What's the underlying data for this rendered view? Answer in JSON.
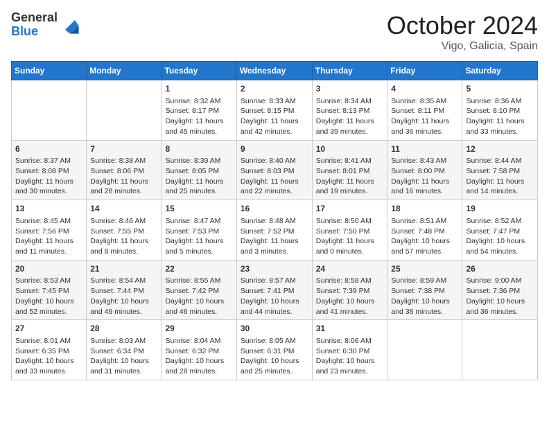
{
  "header": {
    "logo_general": "General",
    "logo_blue": "Blue",
    "month_title": "October 2024",
    "location": "Vigo, Galicia, Spain"
  },
  "days_of_week": [
    "Sunday",
    "Monday",
    "Tuesday",
    "Wednesday",
    "Thursday",
    "Friday",
    "Saturday"
  ],
  "weeks": [
    [
      {
        "day": "",
        "info": ""
      },
      {
        "day": "",
        "info": ""
      },
      {
        "day": "1",
        "info": "Sunrise: 8:32 AM\nSunset: 8:17 PM\nDaylight: 11 hours and 45 minutes."
      },
      {
        "day": "2",
        "info": "Sunrise: 8:33 AM\nSunset: 8:15 PM\nDaylight: 11 hours and 42 minutes."
      },
      {
        "day": "3",
        "info": "Sunrise: 8:34 AM\nSunset: 8:13 PM\nDaylight: 11 hours and 39 minutes."
      },
      {
        "day": "4",
        "info": "Sunrise: 8:35 AM\nSunset: 8:11 PM\nDaylight: 11 hours and 36 minutes."
      },
      {
        "day": "5",
        "info": "Sunrise: 8:36 AM\nSunset: 8:10 PM\nDaylight: 11 hours and 33 minutes."
      }
    ],
    [
      {
        "day": "6",
        "info": "Sunrise: 8:37 AM\nSunset: 8:08 PM\nDaylight: 11 hours and 30 minutes."
      },
      {
        "day": "7",
        "info": "Sunrise: 8:38 AM\nSunset: 8:06 PM\nDaylight: 11 hours and 28 minutes."
      },
      {
        "day": "8",
        "info": "Sunrise: 8:39 AM\nSunset: 8:05 PM\nDaylight: 11 hours and 25 minutes."
      },
      {
        "day": "9",
        "info": "Sunrise: 8:40 AM\nSunset: 8:03 PM\nDaylight: 11 hours and 22 minutes."
      },
      {
        "day": "10",
        "info": "Sunrise: 8:41 AM\nSunset: 8:01 PM\nDaylight: 11 hours and 19 minutes."
      },
      {
        "day": "11",
        "info": "Sunrise: 8:43 AM\nSunset: 8:00 PM\nDaylight: 11 hours and 16 minutes."
      },
      {
        "day": "12",
        "info": "Sunrise: 8:44 AM\nSunset: 7:58 PM\nDaylight: 11 hours and 14 minutes."
      }
    ],
    [
      {
        "day": "13",
        "info": "Sunrise: 8:45 AM\nSunset: 7:56 PM\nDaylight: 11 hours and 11 minutes."
      },
      {
        "day": "14",
        "info": "Sunrise: 8:46 AM\nSunset: 7:55 PM\nDaylight: 11 hours and 8 minutes."
      },
      {
        "day": "15",
        "info": "Sunrise: 8:47 AM\nSunset: 7:53 PM\nDaylight: 11 hours and 5 minutes."
      },
      {
        "day": "16",
        "info": "Sunrise: 8:48 AM\nSunset: 7:52 PM\nDaylight: 11 hours and 3 minutes."
      },
      {
        "day": "17",
        "info": "Sunrise: 8:50 AM\nSunset: 7:50 PM\nDaylight: 11 hours and 0 minutes."
      },
      {
        "day": "18",
        "info": "Sunrise: 8:51 AM\nSunset: 7:48 PM\nDaylight: 10 hours and 57 minutes."
      },
      {
        "day": "19",
        "info": "Sunrise: 8:52 AM\nSunset: 7:47 PM\nDaylight: 10 hours and 54 minutes."
      }
    ],
    [
      {
        "day": "20",
        "info": "Sunrise: 8:53 AM\nSunset: 7:45 PM\nDaylight: 10 hours and 52 minutes."
      },
      {
        "day": "21",
        "info": "Sunrise: 8:54 AM\nSunset: 7:44 PM\nDaylight: 10 hours and 49 minutes."
      },
      {
        "day": "22",
        "info": "Sunrise: 8:55 AM\nSunset: 7:42 PM\nDaylight: 10 hours and 46 minutes."
      },
      {
        "day": "23",
        "info": "Sunrise: 8:57 AM\nSunset: 7:41 PM\nDaylight: 10 hours and 44 minutes."
      },
      {
        "day": "24",
        "info": "Sunrise: 8:58 AM\nSunset: 7:39 PM\nDaylight: 10 hours and 41 minutes."
      },
      {
        "day": "25",
        "info": "Sunrise: 8:59 AM\nSunset: 7:38 PM\nDaylight: 10 hours and 38 minutes."
      },
      {
        "day": "26",
        "info": "Sunrise: 9:00 AM\nSunset: 7:36 PM\nDaylight: 10 hours and 36 minutes."
      }
    ],
    [
      {
        "day": "27",
        "info": "Sunrise: 8:01 AM\nSunset: 6:35 PM\nDaylight: 10 hours and 33 minutes."
      },
      {
        "day": "28",
        "info": "Sunrise: 8:03 AM\nSunset: 6:34 PM\nDaylight: 10 hours and 31 minutes."
      },
      {
        "day": "29",
        "info": "Sunrise: 8:04 AM\nSunset: 6:32 PM\nDaylight: 10 hours and 28 minutes."
      },
      {
        "day": "30",
        "info": "Sunrise: 8:05 AM\nSunset: 6:31 PM\nDaylight: 10 hours and 25 minutes."
      },
      {
        "day": "31",
        "info": "Sunrise: 8:06 AM\nSunset: 6:30 PM\nDaylight: 10 hours and 23 minutes."
      },
      {
        "day": "",
        "info": ""
      },
      {
        "day": "",
        "info": ""
      }
    ]
  ]
}
